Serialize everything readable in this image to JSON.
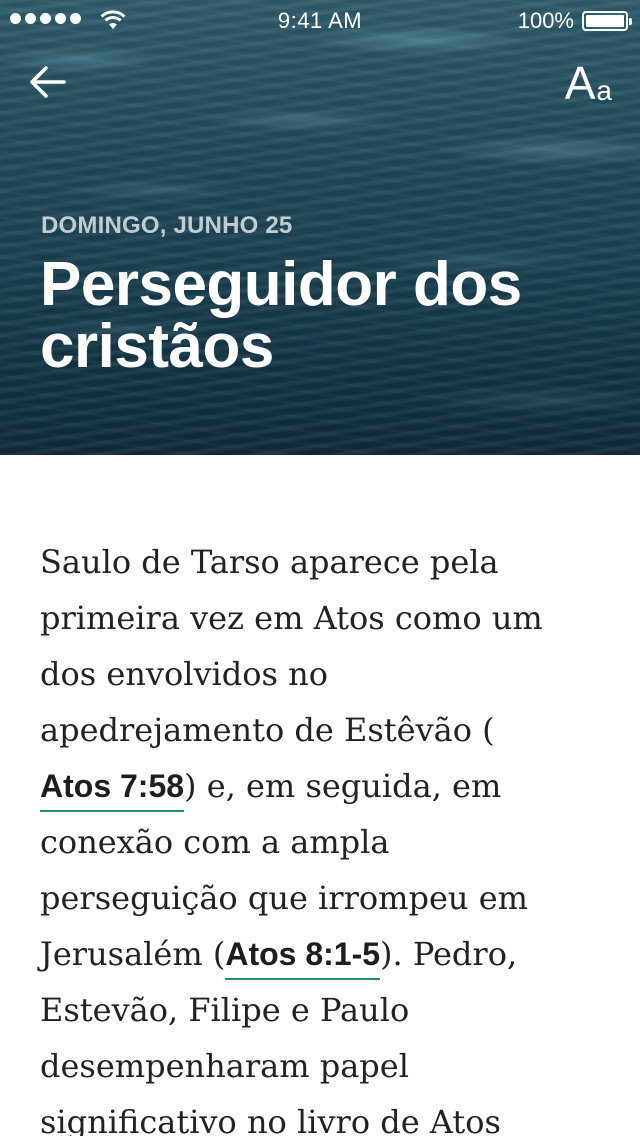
{
  "status_bar": {
    "time": "9:41 AM",
    "battery": "100%"
  },
  "header": {
    "back_icon": "arrow-left-icon",
    "font_settings": {
      "big": "A",
      "small": "a"
    },
    "date": "DOMINGO, JUNHO 25",
    "title": "Perseguidor dos cristãos"
  },
  "article": {
    "lines": [
      "Saulo de Tarso aparece pela",
      "primeira vez em Atos como um",
      "dos envolvidos no",
      "apedrejamento de Estêvão (",
      "e, em seguida, em",
      "conexão com a ampla",
      "perseguição que irrompeu em",
      "Jerusalém (",
      ". Pedro,",
      "Estevão, Filipe e Paulo",
      "desempenharam papel",
      "significativo no livro de Atos"
    ],
    "refs": [
      "Atos 7:58",
      "Atos 8:1-5"
    ],
    "ref_close": ")",
    "accent_color": "#2a8a6e"
  }
}
